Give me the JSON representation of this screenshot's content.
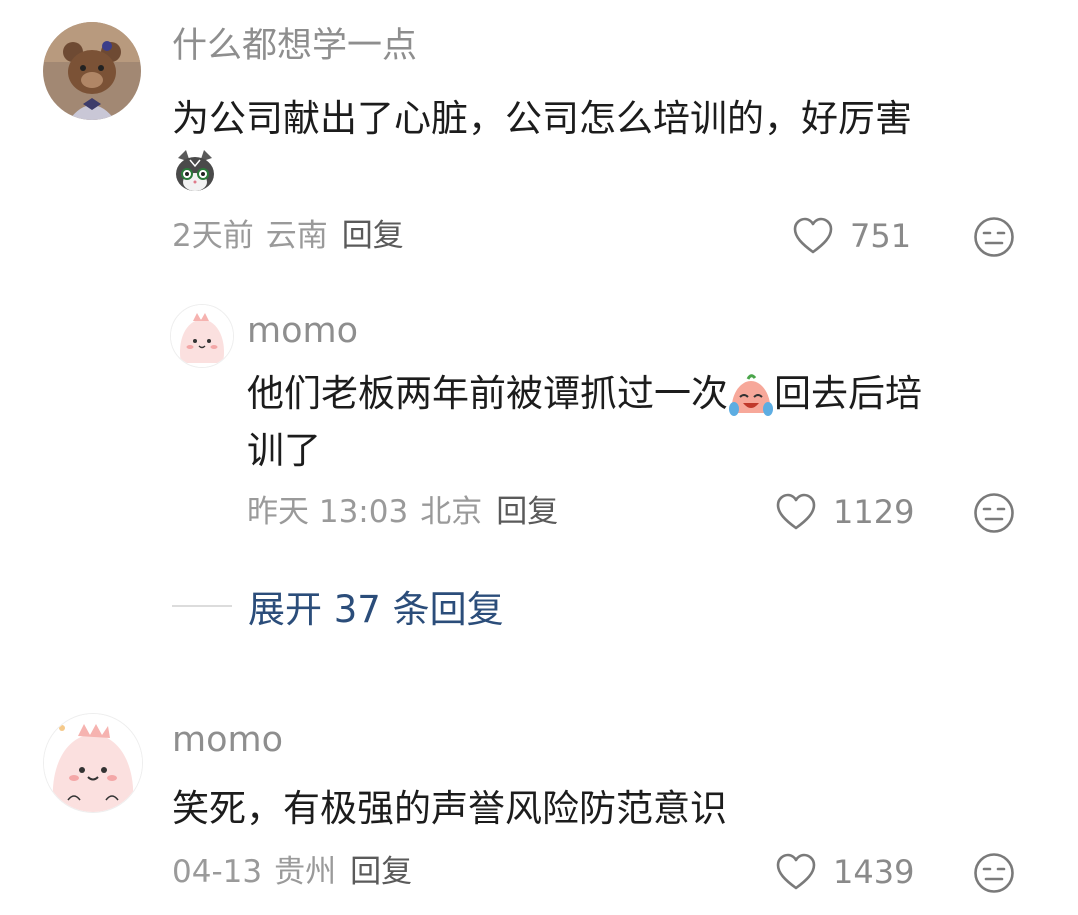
{
  "comments": [
    {
      "username": "什么都想学一点",
      "text_line1": "为公司献出了心脏，公司怎么培训的，好厉害",
      "emoji": "cat-face-emoji",
      "time": "2天前",
      "region": "云南",
      "reply_label": "回复",
      "likes": "751"
    },
    {
      "username": "momo",
      "text_line1_a": "他们老板两年前被谭抓过一次",
      "text_line1_b": "回去后培",
      "text_line2": "训了",
      "emoji": "crying-laughing-peach-emoji",
      "time": "昨天 13:03",
      "region": "北京",
      "reply_label": "回复",
      "likes": "1129"
    },
    {
      "username": "momo",
      "text_line1": "笑死，有极强的声誉风险防范意识",
      "time": "04-13",
      "region": "贵州",
      "reply_label": "回复",
      "likes": "1439"
    }
  ],
  "expand": {
    "label": "展开 37 条回复"
  },
  "colors": {
    "username": "#8e8e8e",
    "meta": "#9a9a9a",
    "expand": "#2b4d7a",
    "icon": "#7a7a7a"
  }
}
